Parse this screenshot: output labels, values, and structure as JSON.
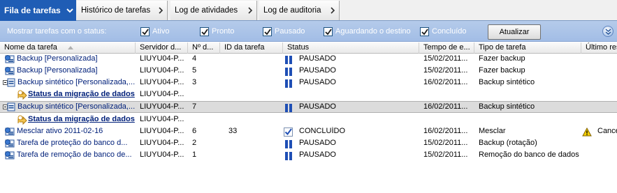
{
  "tabs": [
    {
      "label": "Fila de tarefas"
    },
    {
      "label": "Histórico de tarefas"
    },
    {
      "label": "Log de atividades"
    },
    {
      "label": "Log de auditoria"
    }
  ],
  "filter": {
    "label": "Mostrar tarefas com o status:",
    "options": [
      {
        "label": "Ativo",
        "checked": true
      },
      {
        "label": "Pronto",
        "checked": true
      },
      {
        "label": "Pausado",
        "checked": true
      },
      {
        "label": "Aguardando o destino",
        "checked": true
      },
      {
        "label": "Concluído",
        "checked": true
      }
    ],
    "refresh_label": "Atualizar"
  },
  "columns": {
    "name": "Nome da tarefa",
    "server": "Servidor d...",
    "num": "Nº d...",
    "id": "ID da tarefa",
    "status": "Status",
    "time": "Tempo de e...",
    "type": "Tipo de tarefa",
    "last": "Último res"
  },
  "rows": [
    {
      "name": "Backup [Personalizada]",
      "server": "LIUYU04-P...",
      "num": "4",
      "id": "",
      "status": "PAUSADO",
      "status_icon": "pause-icon",
      "time": "15/02/2011...",
      "type": "Fazer backup",
      "last": "",
      "icon": "job-icon"
    },
    {
      "name": "Backup [Personalizada]",
      "server": "LIUYU04-P...",
      "num": "5",
      "id": "",
      "status": "PAUSADO",
      "status_icon": "pause-icon",
      "time": "15/02/2011...",
      "type": "Fazer backup",
      "last": "",
      "icon": "job-icon"
    },
    {
      "name": "Backup sintético [Personalizada,...",
      "server": "LIUYU04-P...",
      "num": "3",
      "id": "",
      "status": "PAUSADO",
      "status_icon": "pause-icon",
      "time": "16/02/2011...",
      "type": "Backup sintético",
      "last": "",
      "icon": "job-expanded-icon"
    },
    {
      "name": "Status da migração de dados",
      "server": "LIUYU04-P...",
      "sub": true,
      "icon": "migration-icon"
    },
    {
      "name": "Backup sintético [Personalizada,...",
      "server": "LIUYU04-P...",
      "num": "7",
      "id": "",
      "status": "PAUSADO",
      "status_icon": "pause-icon",
      "time": "16/02/2011...",
      "type": "Backup sintético",
      "last": "",
      "icon": "job-expanded-icon",
      "selected": true
    },
    {
      "name": "Status da migração de dados",
      "server": "LIUYU04-P...",
      "sub": true,
      "icon": "migration-icon"
    },
    {
      "name": "Mesclar ativo 2011-02-16",
      "server": "LIUYU04-P...",
      "num": "6",
      "id": "33",
      "status": "CONCLUÍDO",
      "status_icon": "check-icon",
      "time": "16/02/2011...",
      "type": "Mesclar",
      "last": "Cance",
      "last_icon": "warning-icon",
      "icon": "job-icon"
    },
    {
      "name": "Tarefa de proteção do banco d...",
      "server": "LIUYU04-P...",
      "num": "2",
      "id": "",
      "status": "PAUSADO",
      "status_icon": "pause-icon",
      "time": "15/02/2011...",
      "type": "Backup (rotação)",
      "last": "",
      "icon": "job-icon"
    },
    {
      "name": "Tarefa de remoção de banco de...",
      "server": "LIUYU04-P...",
      "num": "1",
      "id": "",
      "status": "PAUSADO",
      "status_icon": "pause-icon",
      "time": "15/02/2011...",
      "type": "Remoção do banco de dados",
      "last": "",
      "icon": "job-icon"
    }
  ]
}
